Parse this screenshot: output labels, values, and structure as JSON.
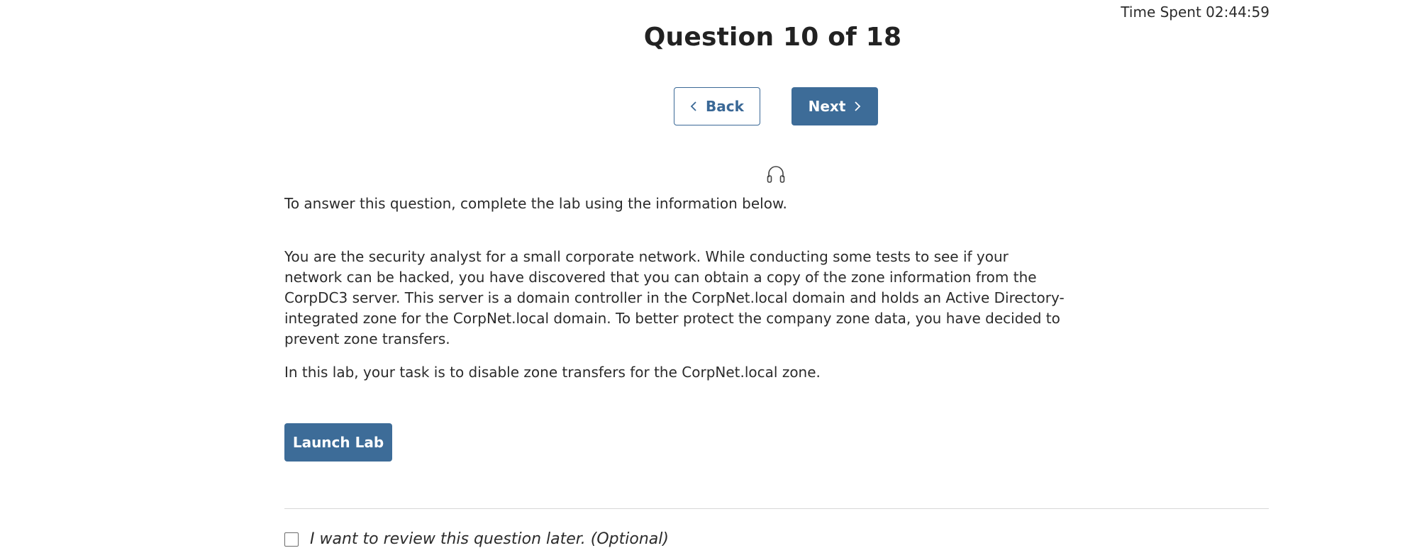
{
  "header": {
    "timer_text": "Time Spent 02:44:59",
    "title": "Question 10 of 18"
  },
  "nav": {
    "back_label": "Back",
    "next_label": "Next"
  },
  "icons": {
    "audio": "headphones-icon",
    "back": "chevron-left-icon",
    "next": "chevron-right-icon"
  },
  "content": {
    "intro": "To answer this question, complete the lab using the information below.",
    "scenario": "You are the security analyst for a small corporate network. While conducting some tests to see if your network can be hacked, you have discovered that you can obtain a copy of the zone information from the CorpDC3 server. This server is a domain controller in the CorpNet.local domain and holds an Active Directory-integrated zone for the CorpNet.local domain. To better protect the company zone data, you have decided to prevent zone transfers.",
    "task": "In this lab, your task is to disable zone transfers for the CorpNet.local zone."
  },
  "actions": {
    "launch_label": "Launch Lab"
  },
  "review": {
    "label": "I want to review this question later. (Optional)",
    "checked": false
  },
  "colors": {
    "primary": "#3d6c98",
    "text": "#2b2b2b",
    "divider": "#d6d6d6"
  }
}
